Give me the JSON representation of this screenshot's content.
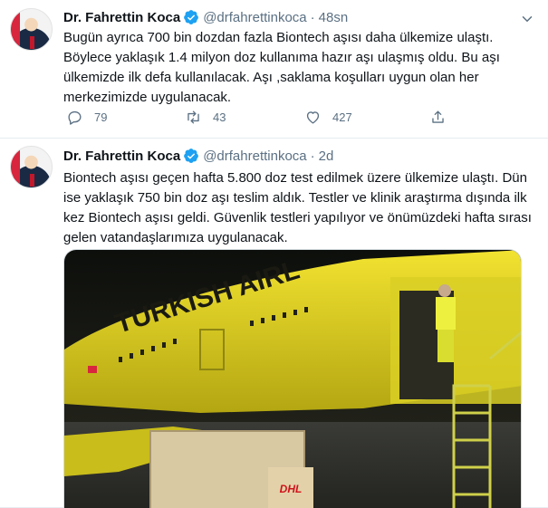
{
  "tweets": [
    {
      "name": "Dr. Fahrettin Koca",
      "handle": "@drfahrettinkoca",
      "separator": "·",
      "time": "48sn",
      "text": "Bugün ayrıca 700 bin dozdan fazla Biontech aşısı daha ülkemize ulaştı.\nBöylece yaklaşık 1.4 milyon doz kullanıma hazır aşı ulaşmış oldu. Bu aşı\nülkemizde ilk defa kullanılacak. Aşı ,saklama koşulları uygun olan her\nmerkezimizde uygulanacak.",
      "replies": "79",
      "retweets": "43",
      "likes": "427"
    },
    {
      "name": "Dr. Fahrettin Koca",
      "handle": "@drfahrettinkoca",
      "separator": "·",
      "time": "2d",
      "text": "Biontech aşısı geçen hafta 5.800 doz test edilmek üzere ülkemize ulaştı. Dün\nise yaklaşık 750 bin doz aşı teslim aldık. Testler ve klinik araştırma dışında ilk\nkez Biontech aşısı geldi. Güvenlik testleri yapılıyor ve önümüzdeki hafta sırası\ngelen vatandaşlarımıza uygulanacak.",
      "media": {
        "plane_text": "TURKISH AIRL",
        "cargo_text": "DHL"
      }
    }
  ],
  "colors": {
    "verified": "#1da1f2",
    "secondary_text": "#5b7083",
    "plane_yellow": "#e8d81a"
  }
}
